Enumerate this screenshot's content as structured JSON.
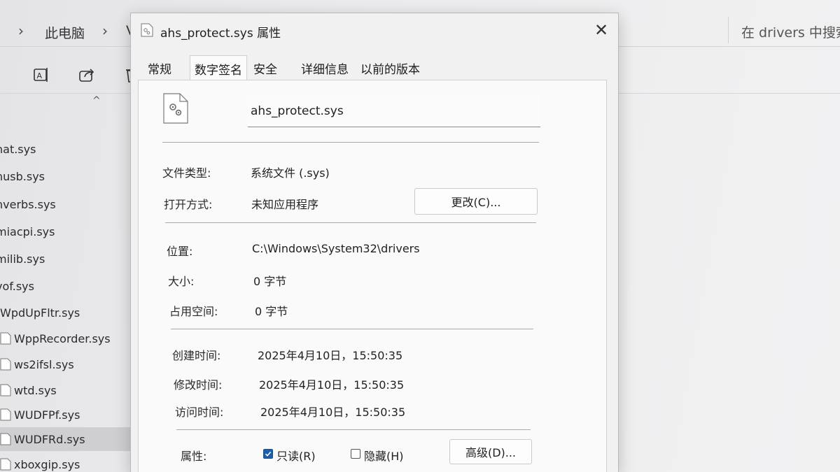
{
  "explorer": {
    "breadcrumb": {
      "item1": "此电脑",
      "item2_partial": "V"
    },
    "search_placeholder": "在 drivers 中搜索",
    "files": [
      {
        "name": "nat.sys"
      },
      {
        "name": "nusb.sys"
      },
      {
        "name": "nverbs.sys"
      },
      {
        "name": "miacpi.sys"
      },
      {
        "name": "milib.sys"
      },
      {
        "name": "vof.sys"
      },
      {
        "name": "WpdUpFltr.sys"
      },
      {
        "name": "WppRecorder.sys"
      },
      {
        "name": "ws2ifsl.sys"
      },
      {
        "name": "wtd.sys"
      },
      {
        "name": "WUDFPf.sys"
      },
      {
        "name": "WUDFRd.sys",
        "selected": true
      },
      {
        "name": "xboxgip.sys"
      }
    ]
  },
  "dialog": {
    "title": "ahs_protect.sys 属性",
    "tabs": [
      "常规",
      "数字签名",
      "安全",
      "详细信息",
      "以前的版本"
    ],
    "active_tab": "常规",
    "filename": "ahs_protect.sys",
    "file_type": {
      "label": "文件类型:",
      "value": "系统文件 (.sys)"
    },
    "opens_with": {
      "label": "打开方式:",
      "value": "未知应用程序",
      "button": "更改(C)..."
    },
    "location": {
      "label": "位置:",
      "value": "C:\\Windows\\System32\\drivers"
    },
    "size": {
      "label": "大小:",
      "value": "0 字节"
    },
    "size_on_disk": {
      "label": "占用空间:",
      "value": "0 字节"
    },
    "created": {
      "label": "创建时间:",
      "value": "2025年4月10日，15:50:35"
    },
    "modified": {
      "label": "修改时间:",
      "value": "2025年4月10日，15:50:35"
    },
    "accessed": {
      "label": "访问时间:",
      "value": "2025年4月10日，15:50:35"
    },
    "attributes": {
      "label": "属性:",
      "readonly": {
        "label": "只读(R)",
        "checked": true
      },
      "hidden": {
        "label": "隐藏(H)",
        "checked": false
      },
      "advanced_button": "高级(D)..."
    }
  }
}
